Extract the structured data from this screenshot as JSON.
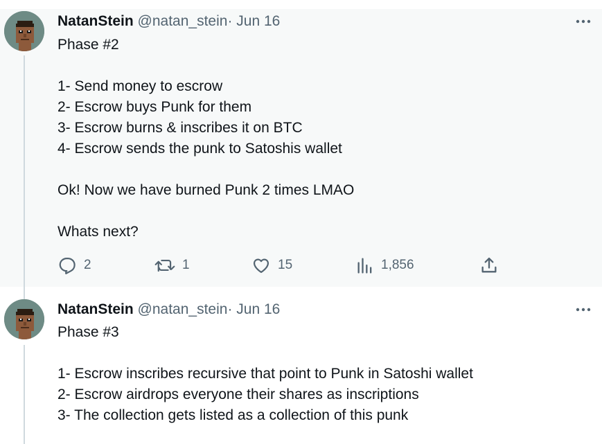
{
  "tweets": [
    {
      "name": "NatanStein",
      "handle": "@natan_stein",
      "separator": "·",
      "date": "Jun 16",
      "lines": [
        "Phase #2",
        "",
        "1- Send money to escrow",
        "2- Escrow buys Punk for them",
        "3- Escrow burns & inscribes it on BTC",
        "4- Escrow sends the punk to Satoshis wallet",
        "",
        "Ok! Now we have burned Punk 2 times LMAO",
        "",
        "Whats next?"
      ],
      "actions": {
        "reply_icon": "reply-icon",
        "reply_count": "2",
        "retweet_icon": "retweet-icon",
        "retweet_count": "1",
        "like_icon": "heart-icon",
        "like_count": "15",
        "views_icon": "analytics-icon",
        "views_count": "1,856",
        "share_icon": "share-icon"
      }
    },
    {
      "name": "NatanStein",
      "handle": "@natan_stein",
      "separator": "·",
      "date": "Jun 16",
      "lines": [
        "Phase #3",
        "",
        "1- Escrow inscribes recursive that point to Punk in Satoshi wallet",
        "2- Escrow airdrops everyone their shares as inscriptions",
        "3- The collection gets listed as a collection of this punk"
      ]
    }
  ],
  "colors": {
    "text_primary": "#0f1419",
    "text_secondary": "#536471",
    "highlight_background": "#f7f9f9",
    "thread_line": "#cfd9de"
  }
}
